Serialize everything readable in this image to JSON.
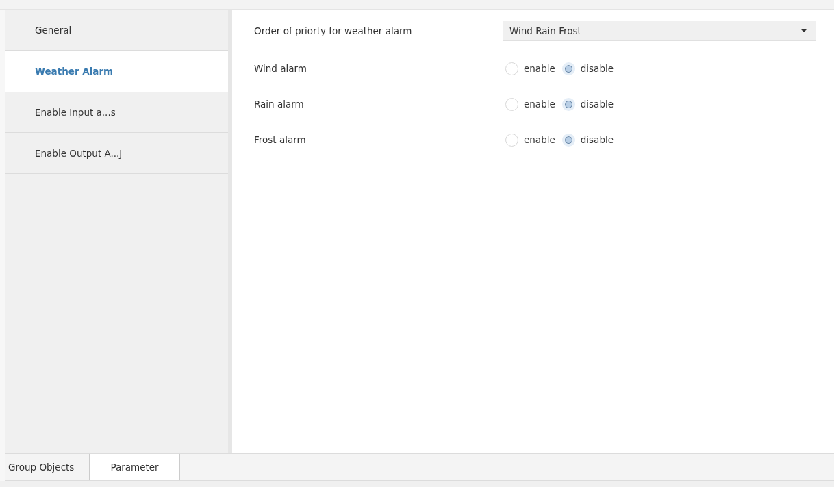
{
  "sidebar": {
    "items": [
      {
        "label": "General",
        "selected": false
      },
      {
        "label": "Weather Alarm",
        "selected": true
      },
      {
        "label": "Enable Input a...s",
        "selected": false
      },
      {
        "label": "Enable Output A...J",
        "selected": false
      }
    ]
  },
  "parameters": [
    {
      "kind": "dropdown",
      "label": "Order of priorty for weather alarm",
      "value": "Wind Rain Frost"
    },
    {
      "kind": "radio",
      "label": "Wind alarm",
      "options": [
        {
          "label": "enable",
          "selected": false
        },
        {
          "label": "disable",
          "selected": true
        }
      ]
    },
    {
      "kind": "radio",
      "label": "Rain alarm",
      "options": [
        {
          "label": "enable",
          "selected": false
        },
        {
          "label": "disable",
          "selected": true
        }
      ]
    },
    {
      "kind": "radio",
      "label": "Frost alarm",
      "options": [
        {
          "label": "enable",
          "selected": false
        },
        {
          "label": "disable",
          "selected": true
        }
      ]
    }
  ],
  "bottom_tabs": [
    {
      "label": "Group Objects",
      "selected": false
    },
    {
      "label": "Parameter",
      "selected": true
    }
  ]
}
